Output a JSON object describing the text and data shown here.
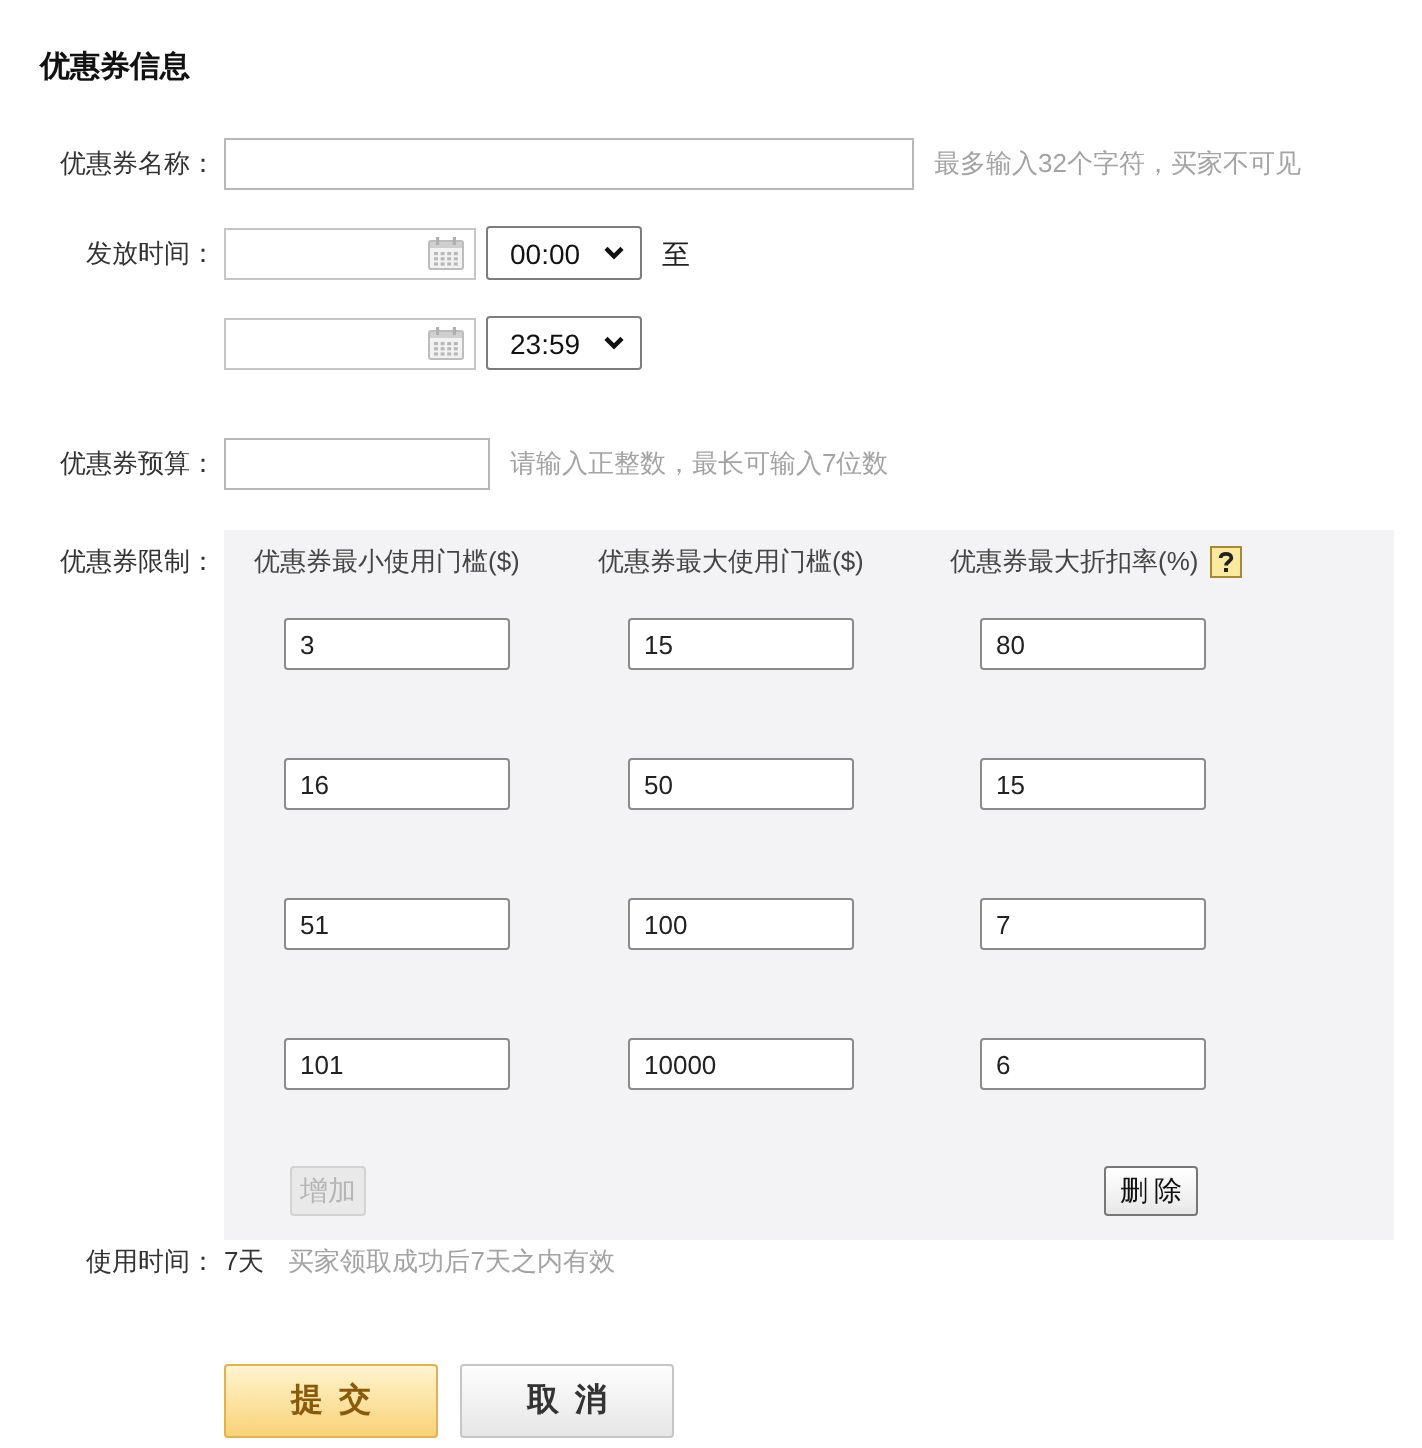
{
  "title": "优惠券信息",
  "name_field": {
    "label": "优惠券名称：",
    "hint": "最多输入32个字符，买家不可见"
  },
  "issue_time": {
    "label": "发放时间：",
    "start_time": "00:00",
    "separator": "至",
    "end_time": "23:59"
  },
  "budget_field": {
    "label": "优惠券预算：",
    "hint": "请输入正整数，最长可输入7位数"
  },
  "limits": {
    "label": "优惠券限制：",
    "columns": [
      {
        "label": "优惠券最小使用门槛($)",
        "help": false
      },
      {
        "label": "优惠券最大使用门槛($)",
        "help": false
      },
      {
        "label": "优惠券最大折扣率(%)",
        "help": true
      }
    ],
    "rows": [
      [
        "3",
        "15",
        "80"
      ],
      [
        "16",
        "50",
        "15"
      ],
      [
        "51",
        "100",
        "7"
      ],
      [
        "101",
        "10000",
        "6"
      ]
    ],
    "add_button": {
      "label": "增加",
      "disabled": true
    },
    "delete_button": {
      "label": "删除",
      "disabled": false
    }
  },
  "usage_time": {
    "label": "使用时间：",
    "value": "7天",
    "hint": "买家领取成功后7天之内有效"
  },
  "actions": [
    {
      "label": "提交",
      "kind": "primary"
    },
    {
      "label": "取消",
      "kind": "secondary"
    }
  ]
}
